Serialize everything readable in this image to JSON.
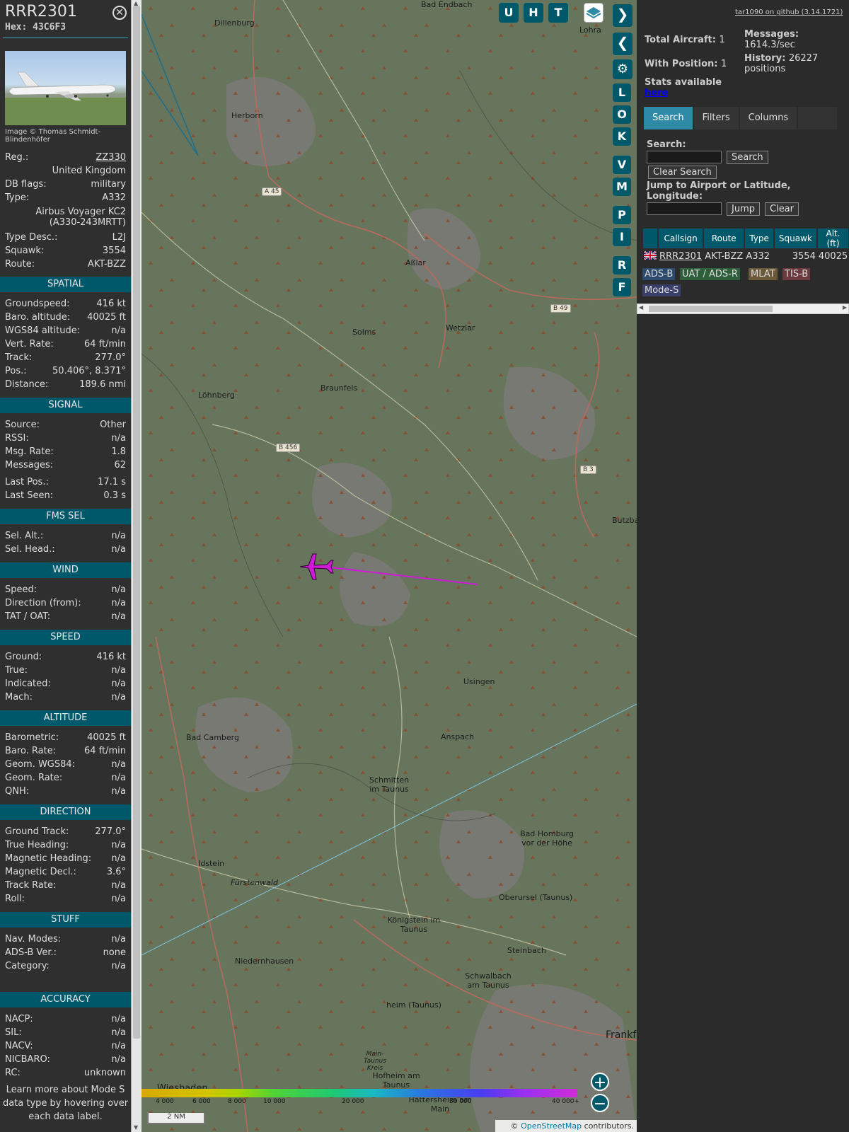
{
  "sidebar": {
    "title": "RRR2301",
    "hex": "Hex: 43C6F3",
    "image_credit": "Image © Thomas Schmidt-Blindenhöfer",
    "info": [
      {
        "label": "Reg.:",
        "value": "ZZ330"
      },
      {
        "label": "",
        "value": "United Kingdom"
      },
      {
        "label": "DB flags:",
        "value": "military"
      },
      {
        "label": "Type:",
        "value": "A332"
      },
      {
        "label": "",
        "value": "Airbus Voyager KC2 (A330-243MRTT)"
      },
      {
        "label": "Type Desc.:",
        "value": "L2J"
      },
      {
        "label": "Squawk:",
        "value": "3554"
      },
      {
        "label": "Route:",
        "value": "AKT-BZZ"
      }
    ],
    "sections": [
      {
        "title": "SPATIAL",
        "rows": [
          [
            "Groundspeed:",
            "416 kt"
          ],
          [
            "Baro. altitude:",
            "40025 ft"
          ],
          [
            "WGS84 altitude:",
            "n/a"
          ],
          [
            "Vert. Rate:",
            "64 ft/min"
          ],
          [
            "Track:",
            "277.0°"
          ],
          [
            "Pos.:",
            "50.406°, 8.371°"
          ],
          [
            "Distance:",
            "189.6 nmi"
          ]
        ]
      },
      {
        "title": "SIGNAL",
        "rows": [
          [
            "Source:",
            "Other"
          ],
          [
            "RSSI:",
            "n/a"
          ],
          [
            "Msg. Rate:",
            "1.8"
          ],
          [
            "Messages:",
            "62"
          ],
          [
            "Last Pos.:",
            "17.1 s"
          ],
          [
            "Last Seen:",
            "0.3 s"
          ]
        ]
      },
      {
        "title": "FMS SEL",
        "rows": [
          [
            "Sel. Alt.:",
            "n/a"
          ],
          [
            "Sel. Head.:",
            "n/a"
          ]
        ]
      },
      {
        "title": "WIND",
        "rows": [
          [
            "Speed:",
            "n/a"
          ],
          [
            "Direction (from):",
            "n/a"
          ],
          [
            "TAT / OAT:",
            "n/a"
          ]
        ]
      },
      {
        "title": "SPEED",
        "rows": [
          [
            "Ground:",
            "416 kt"
          ],
          [
            "True:",
            "n/a"
          ],
          [
            "Indicated:",
            "n/a"
          ],
          [
            "Mach:",
            "n/a"
          ]
        ]
      },
      {
        "title": "ALTITUDE",
        "rows": [
          [
            "Barometric:",
            "40025 ft"
          ],
          [
            "Baro. Rate:",
            "64 ft/min"
          ],
          [
            "Geom. WGS84:",
            "n/a"
          ],
          [
            "Geom. Rate:",
            "n/a"
          ],
          [
            "QNH:",
            "n/a"
          ]
        ]
      },
      {
        "title": "DIRECTION",
        "rows": [
          [
            "Ground Track:",
            "277.0°"
          ],
          [
            "True Heading:",
            "n/a"
          ],
          [
            "Magnetic Heading:",
            "n/a"
          ],
          [
            "Magnetic Decl.:",
            "3.6°"
          ],
          [
            "Track Rate:",
            "n/a"
          ],
          [
            "Roll:",
            "n/a"
          ]
        ]
      },
      {
        "title": "STUFF",
        "rows": [
          [
            "Nav. Modes:",
            "n/a"
          ],
          [
            "ADS-B Ver.:",
            "none"
          ],
          [
            "Category:",
            "n/a"
          ]
        ]
      },
      {
        "title": "ACCURACY",
        "rows": [
          [
            "NACP:",
            "n/a"
          ],
          [
            "SIL:",
            "n/a"
          ],
          [
            "NACV:",
            "n/a"
          ],
          [
            "NICBARO:",
            "n/a"
          ],
          [
            "RC:",
            "unknown"
          ]
        ]
      }
    ],
    "learn_more": "Learn more about Mode S data type by hovering over each data label."
  },
  "map": {
    "buttons": [
      "U",
      "H",
      "T"
    ],
    "side_buttons": [
      "L",
      "O",
      "K",
      "V",
      "M",
      "P",
      "I",
      "R",
      "F"
    ],
    "labels": [
      {
        "t": "Bad Endbach"
      },
      {
        "t": "Dillenburg"
      },
      {
        "t": "Lohra"
      },
      {
        "t": "Herborn"
      },
      {
        "t": "Aßlar"
      },
      {
        "t": "Solms"
      },
      {
        "t": "Wetzlar"
      },
      {
        "t": "Braunfels"
      },
      {
        "t": "Löhnberg"
      },
      {
        "t": "Usingen"
      },
      {
        "t": "Bad Camberg"
      },
      {
        "t": "Anspach"
      },
      {
        "t": "Schmitten im Taunus"
      },
      {
        "t": "Bad Homburg vor der Höhe"
      },
      {
        "t": "Idstein"
      },
      {
        "t": "Fürstenwald"
      },
      {
        "t": "Oberursel (Taunus)"
      },
      {
        "t": "Königstein im Taunus"
      },
      {
        "t": "Niedernhausen"
      },
      {
        "t": "Steinbach"
      },
      {
        "t": "Schwalbach am Taunus"
      },
      {
        "t": "heim (Taunus)"
      },
      {
        "t": "Hofheim am Taunus"
      },
      {
        "t": "Wiesbaden"
      },
      {
        "t": "Main-Taunus Kreis"
      },
      {
        "t": "Hattersheim am Main"
      },
      {
        "t": "Butzba"
      },
      {
        "t": "Frankf"
      }
    ],
    "roads": [
      "A 45",
      "B 49",
      "B 456",
      "B 3"
    ],
    "color_ticks": [
      "4 000",
      "6 000",
      "8 000",
      "10 000",
      "20 000",
      "30 000",
      "40 000+"
    ],
    "scale": "2 NM",
    "attribution_prefix": "©",
    "attribution_link": "OpenStreetMap",
    "attribution_suffix": "contributors."
  },
  "panel": {
    "github": "tar1090 on github (3.14.1721)",
    "total_label": "Total Aircraft:",
    "total": "1",
    "pos_label": "With Position:",
    "pos": "1",
    "msg_label": "Messages:",
    "msg": "1614.3/sec",
    "hist_label": "History:",
    "hist": "26227 positions",
    "stats_label": "Stats available",
    "stats_link": "here",
    "tabs": [
      "Search",
      "Filters",
      "Columns"
    ],
    "search_label": "Search:",
    "search_btn": "Search",
    "clear_search": "Clear Search",
    "jump_label": "Jump to Airport or Latitude, Longitude:",
    "jump_btn": "Jump",
    "clear_btn": "Clear",
    "columns": [
      "Callsign",
      "Route",
      "Type",
      "Squawk",
      "Alt. (ft)"
    ],
    "row": {
      "callsign": "RRR2301",
      "route": "AKT-BZZ",
      "type": "A332",
      "squawk": "3554",
      "alt": "40025"
    },
    "legend": [
      "ADS-B",
      "UAT / ADS-R",
      "MLAT",
      "TIS-B",
      "Mode-S"
    ]
  }
}
